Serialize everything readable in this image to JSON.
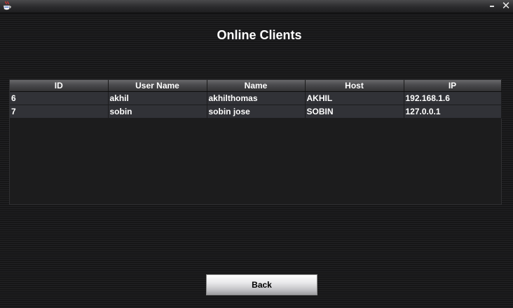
{
  "window": {
    "minimize_glyph": "–",
    "close_glyph": "✕",
    "icon": "java-cup-icon"
  },
  "page": {
    "title": "Online Clients"
  },
  "table": {
    "columns": [
      "ID",
      "User Name",
      "Name",
      "Host",
      "IP"
    ],
    "rows": [
      [
        "6",
        "akhil",
        "akhilthomas",
        "AKHIL",
        "192.168.1.6"
      ],
      [
        "7",
        "sobin",
        "sobin jose",
        "SOBIN",
        "127.0.0.1"
      ]
    ]
  },
  "actions": {
    "back_label": "Back"
  },
  "colors": {
    "background": "#1b1b1c",
    "row_background": "#313237",
    "text": "#ffffff"
  }
}
